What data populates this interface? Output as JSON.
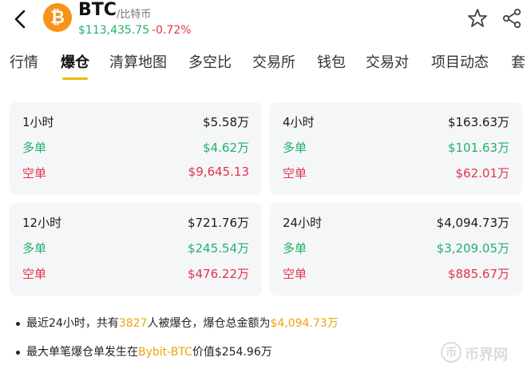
{
  "header": {
    "symbol": "BTC",
    "subtitle": "/比特币",
    "coin_glyph": "₿",
    "price": "$113,435.75",
    "change": "-0.72%",
    "icons": [
      "back-arrow-icon",
      "bitcoin-icon",
      "star-icon",
      "share-icon"
    ]
  },
  "tabs": [
    {
      "label": "行情"
    },
    {
      "label": "爆仓"
    },
    {
      "label": "清算地图"
    },
    {
      "label": "多空比"
    },
    {
      "label": "交易所"
    },
    {
      "label": "钱包"
    },
    {
      "label": "交易对"
    },
    {
      "label": "项目动态"
    },
    {
      "label": "套"
    }
  ],
  "active_tab": "爆仓",
  "cards": [
    {
      "period": "1小时",
      "total": "$5.58万",
      "long_label": "多单",
      "long": "$4.62万",
      "short_label": "空单",
      "short": "$9,645.13"
    },
    {
      "period": "4小时",
      "total": "$163.63万",
      "long_label": "多单",
      "long": "$101.63万",
      "short_label": "空单",
      "short": "$62.01万"
    },
    {
      "period": "12小时",
      "total": "$721.76万",
      "long_label": "多单",
      "long": "$245.54万",
      "short_label": "空单",
      "short": "$476.22万"
    },
    {
      "period": "24小时",
      "total": "$4,094.73万",
      "long_label": "多单",
      "long": "$3,209.05万",
      "short_label": "空单",
      "short": "$885.67万"
    }
  ],
  "notes": {
    "n1_a": "最近24小时，共有",
    "n1_count": "3827",
    "n1_b": "人被爆仓，爆仓总金额为",
    "n1_amount": "$4,094.73万",
    "n2_a": "最大单笔爆仓单发生在",
    "n2_pair": "Bybit-BTC",
    "n2_b": "价值$254.96万"
  },
  "watermark": {
    "glyph": "币",
    "text": "币界网"
  },
  "colors": {
    "green": "#20b26c",
    "red": "#e5334b",
    "accent": "#f0b90b",
    "bitcoin": "#f7931a"
  }
}
